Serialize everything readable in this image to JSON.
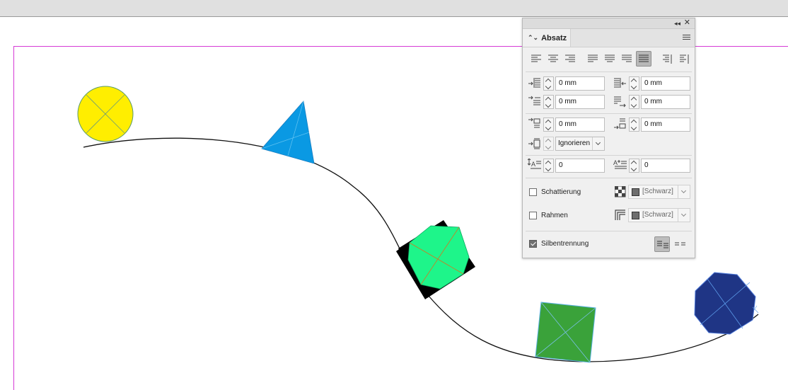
{
  "colors": {
    "margin_guide": "#d63ad6",
    "curve": "#111111",
    "yellow_circle": "#ffee00",
    "blue_triangle": "#0a99e3",
    "green_diamond": "#1ef58a",
    "green_square": "#3aa23a",
    "navy_octagon": "#1f3585",
    "panel_bg": "#f0f0f0"
  },
  "icons": {
    "collapse": "double-left-arrow",
    "close": "close-x",
    "panel_menu": "hamburger-menu",
    "shading_swatch": "checker-grid",
    "border_swatch": "corner-frame"
  },
  "panel": {
    "collapse_glyph": "◂◂",
    "close_glyph": "✕",
    "tab_arrows": "⌃⌄",
    "tab_label": "Absatz",
    "align_buttons": [
      "align-left",
      "align-center",
      "align-right",
      "justify-left",
      "justify-center",
      "justify-right",
      "justify-all",
      "align-toward-spine",
      "align-away-from-spine"
    ],
    "selected_align": "justify-all",
    "fields": {
      "left_indent": "0 mm",
      "right_indent": "0 mm",
      "first_line_indent": "0 mm",
      "last_line_indent": "0 mm",
      "space_before": "0 mm",
      "space_after": "0 mm",
      "baseline_grid": "Ignorieren",
      "drop_cap_lines": "0",
      "drop_cap_chars": "0"
    },
    "shading": {
      "label": "Schattierung",
      "checked": false,
      "color": "[Schwarz]"
    },
    "border": {
      "label": "Rahmen",
      "checked": false,
      "color": "[Schwarz]"
    },
    "hyphenation": {
      "label": "Silbentrennung",
      "checked": true
    }
  }
}
